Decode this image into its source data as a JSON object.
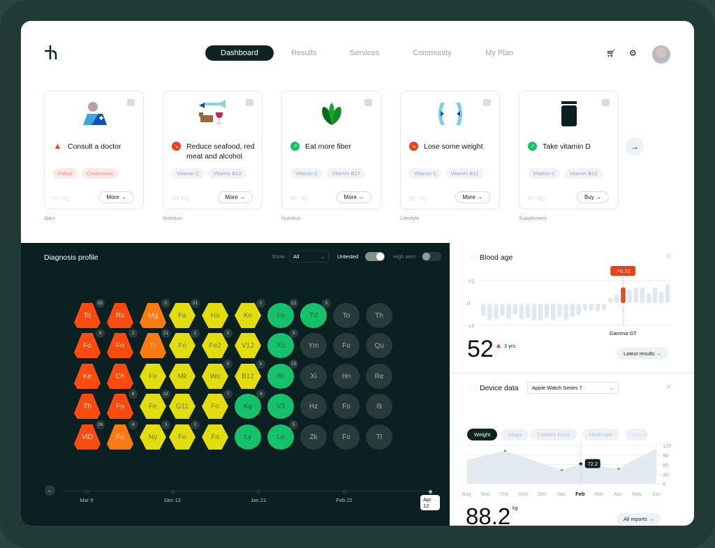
{
  "header": {
    "nav": [
      "Dashboard",
      "Results",
      "Services",
      "Community",
      "My Plan"
    ],
    "active": "Dashboard",
    "icons": [
      "cart-icon",
      "gear-icon",
      "avatar"
    ]
  },
  "cards": [
    {
      "title": "Consult a doctor",
      "status": "alert",
      "tags": [
        "Folate",
        "Cholesterol"
      ],
      "tag_style": "red",
      "button": "More →",
      "category": "Alert",
      "illustration": "doctor-icon"
    },
    {
      "title": "Reduce seafood, red meat and alcohol",
      "status": "decrease",
      "tags": [
        "Vitamin C",
        "Vitamin B12"
      ],
      "button": "More →",
      "category": "Nutrition",
      "illustration": "fish-cow-wine-icon"
    },
    {
      "title": "Eat more fiber",
      "status": "increase",
      "tags": [
        "Vitamin C",
        "Vitamin B12"
      ],
      "button": "More →",
      "category": "Nutrition",
      "illustration": "leaves-icon"
    },
    {
      "title": "Lose some weight",
      "status": "decrease",
      "tags": [
        "Vitamin C",
        "Vitamin B12"
      ],
      "button": "More →",
      "category": "Lifestyle",
      "illustration": "waist-icon"
    },
    {
      "title": "Take vitamin D",
      "status": "increase",
      "tags": [
        "Vitamin C",
        "Vitamin B12"
      ],
      "button": "Buy →",
      "category": "Supplement",
      "illustration": "jar-icon"
    }
  ],
  "colors": {
    "red": "#fb4b0e",
    "orange": "#fb7a12",
    "yellow": "#e3dd0f",
    "green": "#15c26b",
    "grey": "#283a3a",
    "dark": "#0b2020",
    "accent": "#e8431a"
  },
  "diagnosis": {
    "title": "Diagnosis profile",
    "show_label": "Show",
    "show_value": "All",
    "untested_label": "Untested",
    "untested_on": true,
    "high_alert_label": "High alert",
    "high_alert_on": false,
    "grid": [
      [
        [
          "To",
          "red",
          65
        ],
        [
          "Rx",
          "red",
          null
        ],
        [
          "Mg",
          "orange",
          5
        ],
        [
          "Fa",
          "yellow",
          21
        ],
        [
          "Ho",
          "yellow",
          null
        ],
        [
          "Ke",
          "yellow",
          2
        ],
        [
          "Fo",
          "green",
          12
        ],
        [
          "Td",
          "green",
          5
        ],
        [
          "To",
          "grey",
          null
        ],
        [
          "Th",
          "grey",
          null
        ]
      ],
      [
        [
          "Fo",
          "red",
          9
        ],
        [
          "Fo",
          "red",
          2
        ],
        [
          "Tr",
          "orange",
          21
        ],
        [
          "Fo",
          "yellow",
          2
        ],
        [
          "Fe2",
          "yellow",
          5
        ],
        [
          "V12",
          "yellow",
          null
        ],
        [
          "Xo",
          "green",
          3
        ],
        [
          "Ym",
          "grey",
          null
        ],
        [
          "Fo",
          "grey",
          null
        ],
        [
          "Qu",
          "grey",
          null
        ]
      ],
      [
        [
          "Ke",
          "red",
          null
        ],
        [
          "Ch",
          "red",
          null
        ],
        [
          "Fo",
          "yellow",
          null
        ],
        [
          "Mk",
          "yellow",
          null
        ],
        [
          "Wo",
          "yellow",
          6
        ],
        [
          "B12",
          "yellow",
          5
        ],
        [
          "Ri",
          "green",
          15
        ],
        [
          "Xi",
          "grey",
          null
        ],
        [
          "Hn",
          "grey",
          null
        ],
        [
          "Re",
          "grey",
          null
        ]
      ],
      [
        [
          "Th",
          "red",
          null
        ],
        [
          "Fo",
          "red",
          8
        ],
        [
          "Fe",
          "yellow",
          11
        ],
        [
          "G11",
          "yellow",
          null
        ],
        [
          "Fo",
          "yellow",
          7
        ],
        [
          "Kg",
          "green",
          4
        ],
        [
          "V3",
          "green",
          null
        ],
        [
          "Hz",
          "grey",
          null
        ],
        [
          "Fo",
          "grey",
          null
        ],
        [
          "i9",
          "grey",
          null
        ]
      ],
      [
        [
          "ViD",
          "red",
          26
        ],
        [
          "Fo",
          "orange",
          4
        ],
        [
          "Ny",
          "yellow",
          3
        ],
        [
          "Fo",
          "yellow",
          2
        ],
        [
          "Fo",
          "yellow",
          null
        ],
        [
          "Ly",
          "green",
          null
        ],
        [
          "Lo",
          "green",
          5
        ],
        [
          "Zk",
          "grey",
          null
        ],
        [
          "Fo",
          "grey",
          null
        ],
        [
          "Tl",
          "grey",
          null
        ]
      ]
    ],
    "timeline": [
      "Mar 5",
      "Dec 12",
      "Jan 21",
      "Feb 22",
      "Apr 12"
    ],
    "timeline_selected": "Apr 12"
  },
  "blood_age": {
    "title": "Blood age",
    "y_ticks": [
      "↗2",
      "0",
      "↘2"
    ],
    "values": [
      -1.1,
      -1.5,
      -1.4,
      -1.1,
      -1.4,
      -1.0,
      -1.4,
      -1.3,
      -1.5,
      -1.5,
      -1.3,
      -1.5,
      -1.2,
      -1.5,
      -1.2,
      -1.0,
      -0.6,
      -0.6,
      -0.7,
      -0.6,
      0.5,
      0.8,
      1.4,
      1.2,
      1.4,
      1.4,
      0.9,
      1.4,
      1.0,
      1.7
    ],
    "highlight_index": 22,
    "highlight_label": "↗0,72",
    "highlight_name": "Gamma GT",
    "value": "52",
    "delta": "3 yrs",
    "button": "Latest results →"
  },
  "device": {
    "title": "Device data",
    "device": "Apple Watch Series 7",
    "tabs": [
      "Weight",
      "Steps",
      "Calories burnt",
      "Heart rate",
      "Blood"
    ],
    "active_tab": "Weight",
    "chart_data": {
      "type": "area",
      "x": [
        "Aug",
        "Sep",
        "Oct",
        "Nov",
        "Dec",
        "Jan",
        "Feb",
        "Mar",
        "Apr",
        "May",
        "Jun"
      ],
      "values": [
        75,
        89,
        103,
        83,
        63,
        43,
        62,
        55,
        47,
        80,
        110
      ],
      "y_ticks": [
        "120",
        "90",
        "60",
        "30",
        "0"
      ],
      "ylim": [
        0,
        120
      ],
      "selected": "Feb",
      "selected_label": "72.2"
    },
    "value": "88.2",
    "unit": "kg",
    "button": "All reports →"
  }
}
